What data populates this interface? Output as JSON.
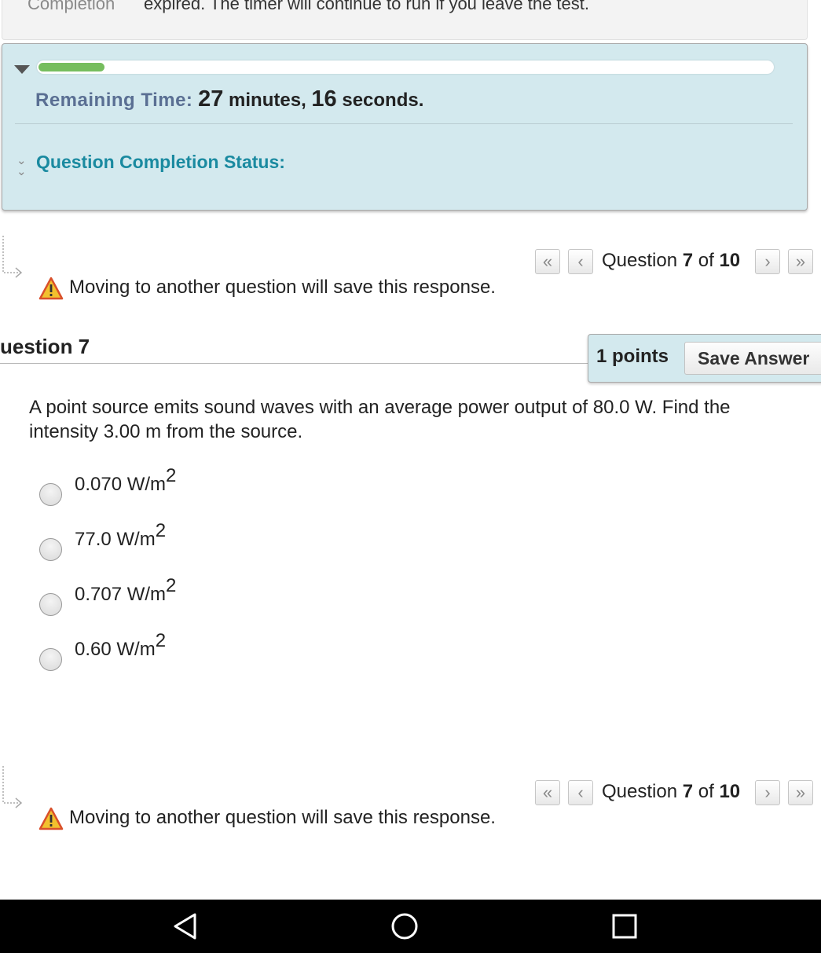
{
  "top_info": {
    "label": "Completion",
    "text": "expired. The timer will continue to run if you leave the test."
  },
  "timer": {
    "progress_fraction": 0.09,
    "remaining_label": "Remaining Time:",
    "minutes": "27",
    "minutes_unit": "minutes,",
    "seconds": "16",
    "seconds_unit": "seconds.",
    "completion_status_label": "Question Completion Status:"
  },
  "navigation": {
    "question_word": "Question",
    "current": "7",
    "of_word": "of",
    "total": "10",
    "first_icon": "double-chevron-left-icon",
    "prev_icon": "chevron-left-icon",
    "next_icon": "chevron-right-icon",
    "last_icon": "double-chevron-right-icon",
    "warning_icon": "warning-triangle-icon",
    "warning_text": "Moving to another question will save this response."
  },
  "question": {
    "title": "uestion 7",
    "points": "1 points",
    "save_label": "Save Answer",
    "text": "A point source emits sound waves with an average power output of 80.0 W. Find the intensity 3.00 m from the source.",
    "options": [
      {
        "value": "0.070 W/m",
        "exp": "2"
      },
      {
        "value": "77.0 W/m",
        "exp": "2"
      },
      {
        "value": "0.707 W/m",
        "exp": "2"
      },
      {
        "value": "0.60 W/m",
        "exp": "2"
      }
    ]
  },
  "system_bar": {
    "back_icon": "back-triangle-icon",
    "home_icon": "home-circle-icon",
    "recents_icon": "recents-square-icon"
  },
  "colors": {
    "panel_bg": "#d3e9ee",
    "progress_fill": "#76bd5e",
    "status_link": "#1a8aa0",
    "remaining_label": "#5a6f93"
  }
}
